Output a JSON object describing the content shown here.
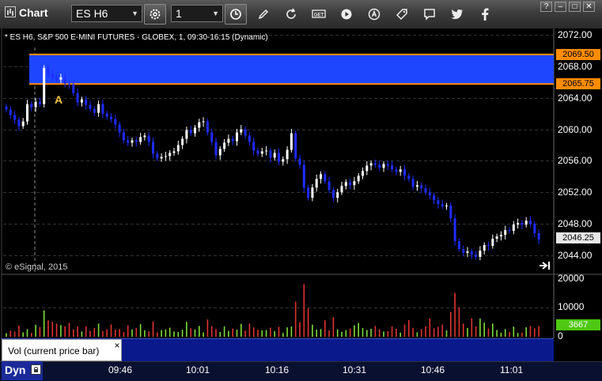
{
  "toolbar": {
    "app_title": "Chart",
    "symbol_value": "ES H6",
    "interval_value": "1",
    "icons": [
      "settings-icon",
      "clock-icon",
      "pencil-icon",
      "refresh-icon",
      "get-icon",
      "play-icon",
      "alert-icon",
      "tag-icon",
      "chat-icon",
      "twitter-icon",
      "facebook-icon"
    ],
    "window_buttons": {
      "help": "?",
      "minimize": "–",
      "maximize": "□",
      "close": "✕"
    }
  },
  "chart": {
    "title": "* ES H6, S&P 500 E-MINI FUTURES - GLOBEX, 1, 09:30-16:15 (Dynamic)",
    "watermark": "© eSignal, 2015",
    "marker_label": "A",
    "colors": {
      "up": "#ffffff",
      "down": "#1f2cff",
      "zone": "#1e46ff",
      "zone_line": "#ff8c00",
      "vol_up": "#7ddc3c",
      "vol_down": "#e03232"
    },
    "price_axis": [
      "2072.00",
      "2068.00",
      "2064.00",
      "2060.00",
      "2056.00",
      "2052.00",
      "2048.00",
      "2044.00"
    ],
    "zone_top_label": "2069.50",
    "zone_bottom_label": "2065.75",
    "last_price_label": "2046.25"
  },
  "volume": {
    "axis": [
      "20000",
      "10000",
      "0"
    ],
    "last_label": "3667",
    "indicator_label": "Vol (current price bar)",
    "close_glyph": "×"
  },
  "time_axis": [
    "09:46",
    "10:01",
    "10:16",
    "10:31",
    "10:46",
    "11:01"
  ],
  "footer": {
    "mode_label": "Dyn"
  },
  "chart_data": {
    "type": "candlestick",
    "title": "* ES H6, S&P 500 E-MINI FUTURES - GLOBEX, 1, 09:30-16:15 (Dynamic)",
    "ylim": [
      2042.0,
      2074.0
    ],
    "zone": [
      2065.75,
      2069.5
    ],
    "closes": [
      2062.5,
      2061.8,
      2061.2,
      2060.4,
      2061.0,
      2063.2,
      2062.8,
      2063.5,
      2063.2,
      2067.8,
      2067.0,
      2066.6,
      2066.3,
      2066.6,
      2065.8,
      2065.7,
      2064.6,
      2063.4,
      2063.8,
      2063.1,
      2062.6,
      2062.1,
      2063.2,
      2062.0,
      2061.6,
      2061.3,
      2060.6,
      2059.6,
      2058.6,
      2058.3,
      2058.6,
      2058.4,
      2059.0,
      2059.2,
      2058.4,
      2056.9,
      2056.3,
      2056.5,
      2056.6,
      2057.0,
      2057.2,
      2058.0,
      2058.8,
      2059.9,
      2059.5,
      2060.2,
      2060.9,
      2061.0,
      2059.6,
      2058.4,
      2056.7,
      2057.5,
      2058.3,
      2058.8,
      2058.5,
      2059.6,
      2060.0,
      2059.2,
      2058.4,
      2057.3,
      2056.9,
      2057.2,
      2057.3,
      2056.4,
      2057.0,
      2055.9,
      2056.2,
      2057.4,
      2059.5,
      2056.3,
      2055.5,
      2052.6,
      2051.3,
      2052.6,
      2053.7,
      2054.3,
      2053.4,
      2052.3,
      2051.3,
      2052.0,
      2052.8,
      2053.3,
      2052.9,
      2053.4,
      2054.1,
      2054.7,
      2055.4,
      2055.7,
      2055.5,
      2055.1,
      2055.6,
      2055.4,
      2054.9,
      2054.6,
      2054.9,
      2054.1,
      2053.7,
      2052.7,
      2052.9,
      2052.5,
      2052.0,
      2051.6,
      2051.0,
      2050.5,
      2050.2,
      2050.3,
      2048.7,
      2045.8,
      2044.8,
      2044.3,
      2044.5,
      2044.1,
      2043.8,
      2044.6,
      2045.3,
      2045.2,
      2046.1,
      2046.4,
      2046.6,
      2047.2,
      2047.1,
      2047.9,
      2048.1,
      2047.9,
      2048.4,
      2048.0,
      2046.8,
      2046.0
    ],
    "volume_ylim": [
      0,
      20000
    ],
    "volumes": [
      1200,
      2100,
      1800,
      3800,
      1500,
      2600,
      1300,
      4100,
      3300,
      9000,
      5600,
      5100,
      4500,
      4000,
      3600,
      4800,
      2500,
      3500,
      1800,
      3600,
      2000,
      3000,
      4500,
      1900,
      2600,
      4200,
      2400,
      2600,
      1600,
      3900,
      2500,
      3000,
      4300,
      2200,
      1800,
      5200,
      1500,
      2300,
      2500,
      3100,
      1800,
      1600,
      2400,
      5100,
      2900,
      2500,
      3700,
      1500,
      5900,
      3700,
      2600,
      1600,
      3500,
      2000,
      2800,
      2400,
      4400,
      2100,
      4500,
      3200,
      2400,
      2200,
      2300,
      3100,
      1900,
      3400,
      1300,
      3200,
      3500,
      12000,
      5000,
      18000,
      9700,
      4100,
      2400,
      2600,
      5600,
      2200,
      6700,
      2500,
      1700,
      2300,
      2800,
      3900,
      4700,
      3000,
      2300,
      2700,
      3700,
      2500,
      1800,
      1900,
      3500,
      2700,
      1400,
      4200,
      5700,
      3000,
      1500,
      2600,
      3500,
      6200,
      2900,
      3400,
      4200,
      2200,
      8500,
      15000,
      10000,
      4500,
      3000,
      6300,
      3500,
      6200,
      4800,
      2800,
      4500,
      2300,
      1400,
      2600,
      1600,
      3500,
      1300,
      1400,
      3200,
      3700,
      2900,
      3667
    ]
  }
}
